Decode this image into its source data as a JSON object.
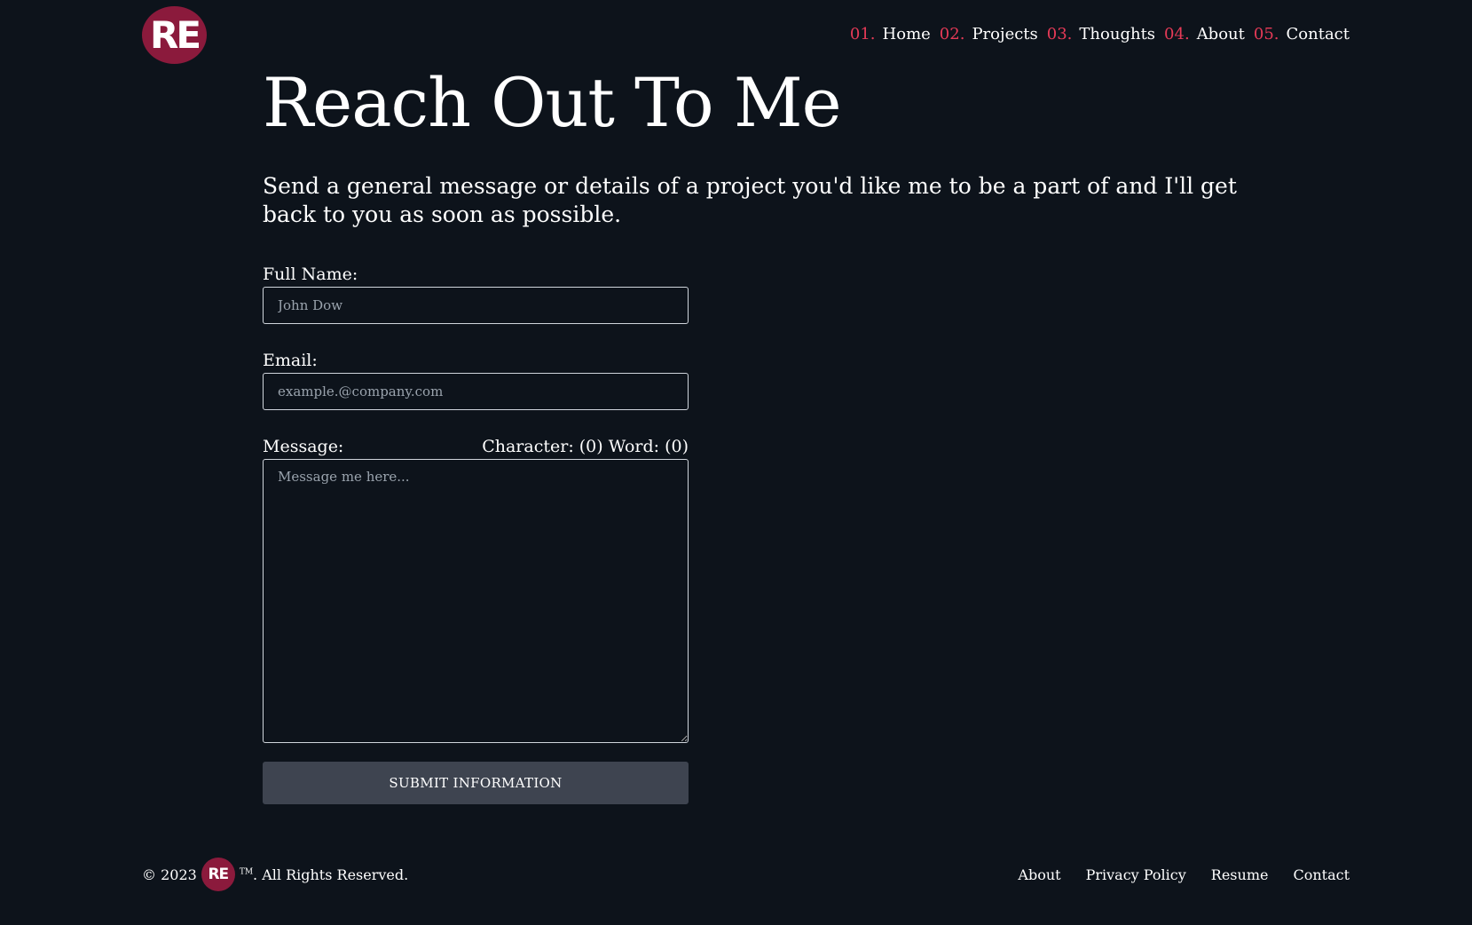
{
  "header": {
    "logo_text": "RE",
    "nav": [
      {
        "num": "01.",
        "label": "Home"
      },
      {
        "num": "02.",
        "label": "Projects"
      },
      {
        "num": "03.",
        "label": "Thoughts"
      },
      {
        "num": "04.",
        "label": "About"
      },
      {
        "num": "05.",
        "label": "Contact"
      }
    ]
  },
  "main": {
    "title": "Reach Out To Me",
    "subtitle": "Send a general message or details of a project you'd like me to be a part of and I'll get back to you as soon as possible."
  },
  "form": {
    "name_label": "Full Name:",
    "name_placeholder": "John Dow",
    "email_label": "Email:",
    "email_placeholder": "example.@company.com",
    "message_label": "Message:",
    "counter": "Character: (0) Word: (0)",
    "message_placeholder": "Message me here...",
    "submit_label": "SUBMIT INFORMATION"
  },
  "footer": {
    "copyright_prefix": "© 2023",
    "logo_text": "RE",
    "tm": "TM",
    "copyright_suffix": ". All Rights Reserved.",
    "links": [
      "About",
      "Privacy Policy",
      "Resume",
      "Contact"
    ]
  },
  "colors": {
    "background": "#0d131b",
    "accent": "#e63a57",
    "logo_bg": "#8b1a3c",
    "button_bg": "#3e4450"
  }
}
